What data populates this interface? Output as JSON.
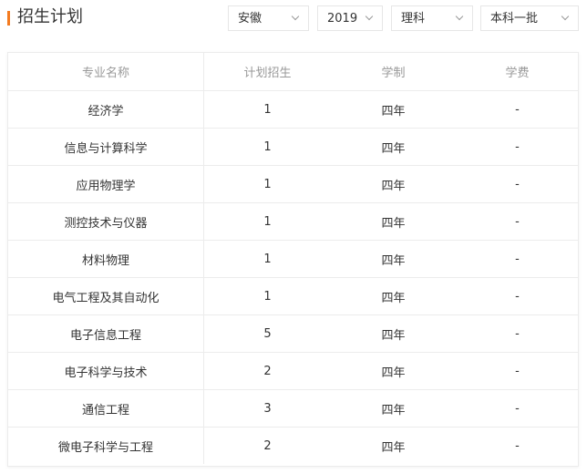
{
  "header": {
    "title": "招生计划"
  },
  "filters": {
    "province": "安徽",
    "year": "2019",
    "subject": "理科",
    "batch": "本科一批"
  },
  "table": {
    "columns": [
      "专业名称",
      "计划招生",
      "学制",
      "学费"
    ],
    "rows": [
      {
        "major": "经济学",
        "plan": "1",
        "duration": "四年",
        "fee": "-"
      },
      {
        "major": "信息与计算科学",
        "plan": "1",
        "duration": "四年",
        "fee": "-"
      },
      {
        "major": "应用物理学",
        "plan": "1",
        "duration": "四年",
        "fee": "-"
      },
      {
        "major": "测控技术与仪器",
        "plan": "1",
        "duration": "四年",
        "fee": "-"
      },
      {
        "major": "材料物理",
        "plan": "1",
        "duration": "四年",
        "fee": "-"
      },
      {
        "major": "电气工程及其自动化",
        "plan": "1",
        "duration": "四年",
        "fee": "-"
      },
      {
        "major": "电子信息工程",
        "plan": "5",
        "duration": "四年",
        "fee": "-"
      },
      {
        "major": "电子科学与技术",
        "plan": "2",
        "duration": "四年",
        "fee": "-"
      },
      {
        "major": "通信工程",
        "plan": "3",
        "duration": "四年",
        "fee": "-"
      },
      {
        "major": "微电子科学与工程",
        "plan": "2",
        "duration": "四年",
        "fee": "-"
      }
    ]
  },
  "colors": {
    "accent": "#f47b20",
    "border": "#ececec",
    "header_text": "#999999",
    "body_text": "#333333"
  }
}
